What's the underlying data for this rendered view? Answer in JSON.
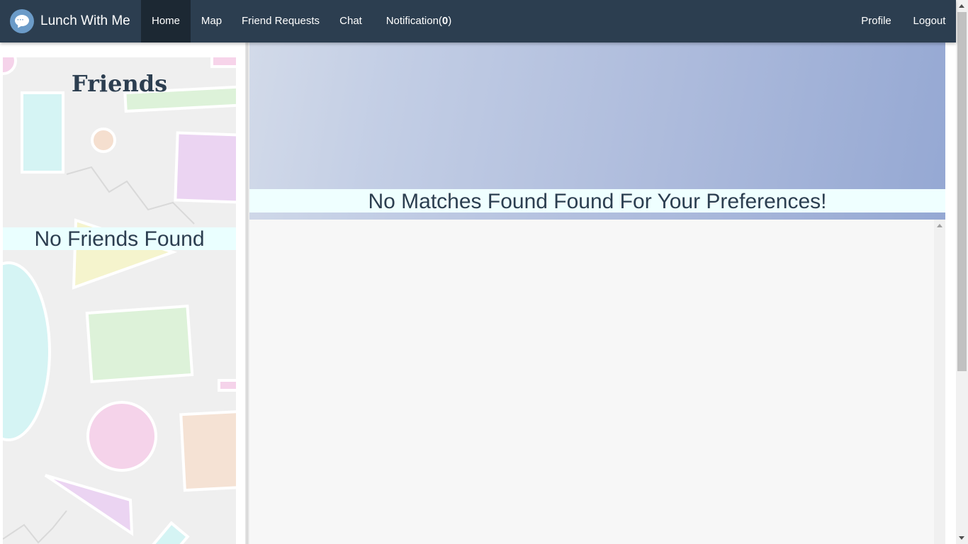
{
  "brand": {
    "name": "Lunch With Me",
    "logo_icon": "chat-bubble-icon"
  },
  "nav": {
    "home": "Home",
    "map": "Map",
    "friend_requests": "Friend Requests",
    "chat": "Chat",
    "notification_label": "Notification(",
    "notification_count": "0",
    "notification_close": ")",
    "profile": "Profile",
    "logout": "Logout"
  },
  "friends_panel": {
    "title": "Friends",
    "empty_message": "No Friends Found"
  },
  "main": {
    "empty_message": "No Matches Found Found For Your Preferences!"
  },
  "colors": {
    "navbar": "#2c3e50",
    "navbar_active": "#1c2833",
    "heading_text": "#2c3e50",
    "empty_banner": "#eaffff",
    "hero_start": "#d2dae9",
    "hero_end": "#95a8d3"
  }
}
